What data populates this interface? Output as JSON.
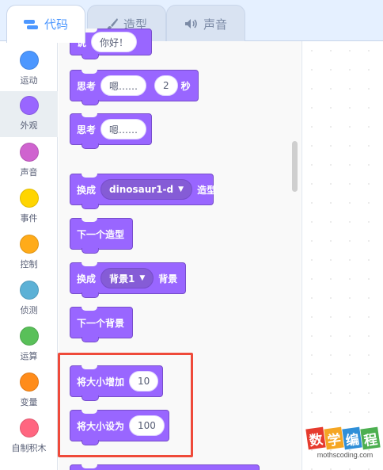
{
  "tabs": [
    {
      "label": "代码",
      "icon": "code-icon",
      "active": true
    },
    {
      "label": "造型",
      "icon": "brush-icon",
      "active": false
    },
    {
      "label": "声音",
      "icon": "speaker-icon",
      "active": false
    }
  ],
  "categories": [
    {
      "label": "运动",
      "color": "#4c97ff"
    },
    {
      "label": "外观",
      "color": "#9966ff"
    },
    {
      "label": "声音",
      "color": "#cf63cf"
    },
    {
      "label": "事件",
      "color": "#ffd500"
    },
    {
      "label": "控制",
      "color": "#ffab19"
    },
    {
      "label": "侦测",
      "color": "#5cb1d6"
    },
    {
      "label": "运算",
      "color": "#59c059"
    },
    {
      "label": "变量",
      "color": "#ff8c1a"
    },
    {
      "label": "自制积木",
      "color": "#ff6680"
    }
  ],
  "blocks": {
    "say_partial": {
      "text": "说",
      "input": "你好！"
    },
    "think_secs": {
      "text": "思考",
      "input": "嗯……",
      "secs": "2",
      "unit": "秒"
    },
    "think": {
      "text": "思考",
      "input": "嗯……"
    },
    "switch_costume": {
      "text": "换成",
      "dropdown": "dinosaur1-d",
      "suffix": "造型"
    },
    "next_costume": {
      "text": "下一个造型"
    },
    "switch_backdrop": {
      "text": "换成",
      "dropdown": "背景1",
      "suffix": "背景"
    },
    "next_backdrop": {
      "text": "下一个背景"
    },
    "change_size": {
      "text": "将大小增加",
      "input": "10"
    },
    "set_size": {
      "text": "将大小设为",
      "input": "100"
    }
  },
  "watermark": {
    "chars": [
      "数",
      "学",
      "编",
      "程"
    ],
    "colors": [
      "#e63b2e",
      "#f5a623",
      "#2f8fd8",
      "#4caf50"
    ],
    "site": "mothscoding.com"
  }
}
